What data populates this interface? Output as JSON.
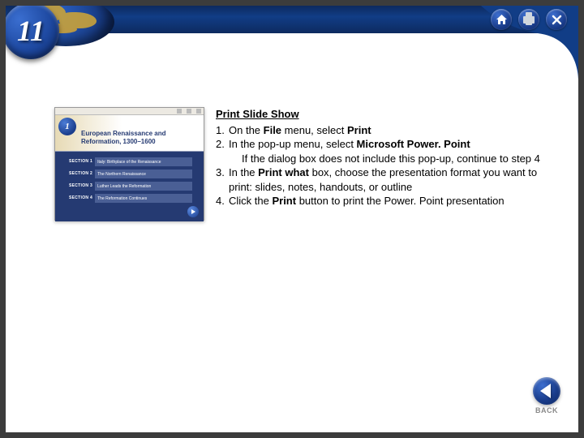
{
  "badge_number": "11",
  "title": "Print Slide Show",
  "steps": [
    {
      "num": "1.",
      "parts": [
        "On the ",
        "File",
        " menu, select ",
        "Print"
      ]
    },
    {
      "num": "2.",
      "parts": [
        "In the pop-up menu, select ",
        "Microsoft Power. Point"
      ]
    },
    {
      "num": "",
      "indent": true,
      "parts": [
        "If the dialog box does not include this pop-up, continue to step 4"
      ]
    },
    {
      "num": "3.",
      "parts": [
        "In the ",
        "Print what",
        " box, choose the presentation format you want to print: slides, notes, handouts, or outline"
      ]
    },
    {
      "num": "4.",
      "parts": [
        "Click the ",
        "Print",
        " button to print the Power. Point presentation"
      ]
    }
  ],
  "thumb": {
    "badge": "1",
    "title": "European Renaissance and Reformation, 1300–1600",
    "sections": [
      {
        "tag": "SECTION 1",
        "label": "Italy: Birthplace of the Renaissance"
      },
      {
        "tag": "SECTION 2",
        "label": "The Northern Renaissance"
      },
      {
        "tag": "SECTION 3",
        "label": "Luther Leads the Reformation"
      },
      {
        "tag": "SECTION 4",
        "label": "The Reformation Continues"
      }
    ]
  },
  "back_label": "BACK"
}
